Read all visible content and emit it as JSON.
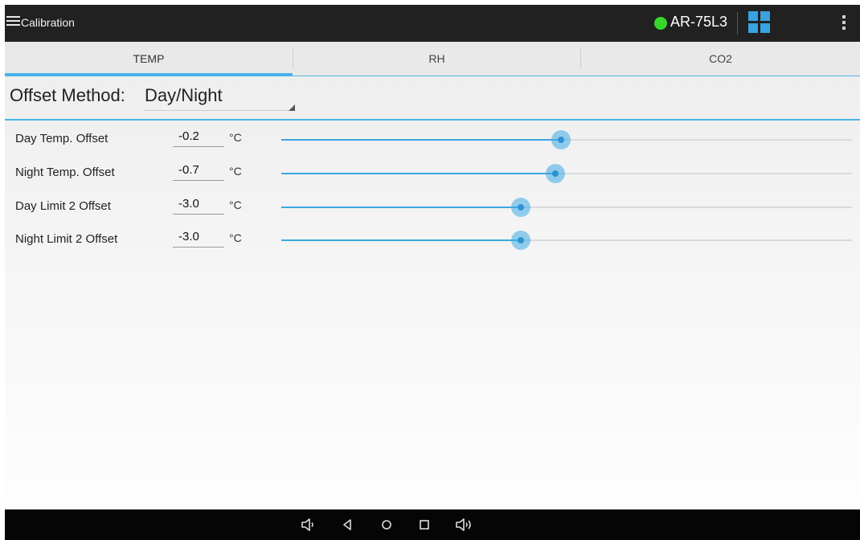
{
  "app_bar": {
    "title": "Calibration",
    "device_name": "AR-75L3",
    "status_color": "#37d62a",
    "icons": [
      "menu-icon",
      "grid-icon",
      "overflow-menu-icon"
    ]
  },
  "tabs": [
    {
      "label": "TEMP",
      "selected": true
    },
    {
      "label": "RH",
      "selected": false
    },
    {
      "label": "CO2",
      "selected": false
    }
  ],
  "offset_method": {
    "label": "Offset Method:",
    "value": "Day/Night"
  },
  "offsets": [
    {
      "label": "Day Temp. Offset",
      "value": "-0.2",
      "unit": "°C",
      "slider_fraction": 0.49
    },
    {
      "label": "Night Temp. Offset",
      "value": "-0.7",
      "unit": "°C",
      "slider_fraction": 0.48
    },
    {
      "label": "Day Limit 2 Offset",
      "value": "-3.0",
      "unit": "°C",
      "slider_fraction": 0.42
    },
    {
      "label": "Night Limit 2 Offset",
      "value": "-3.0",
      "unit": "°C",
      "slider_fraction": 0.42
    }
  ],
  "nav_bar": {
    "buttons": [
      "volume-down-icon",
      "back-icon",
      "home-icon",
      "recents-icon",
      "volume-up-icon"
    ]
  },
  "colors": {
    "accent": "#47b3e8",
    "app_bar": "#212121",
    "nav_bar": "#050505"
  }
}
